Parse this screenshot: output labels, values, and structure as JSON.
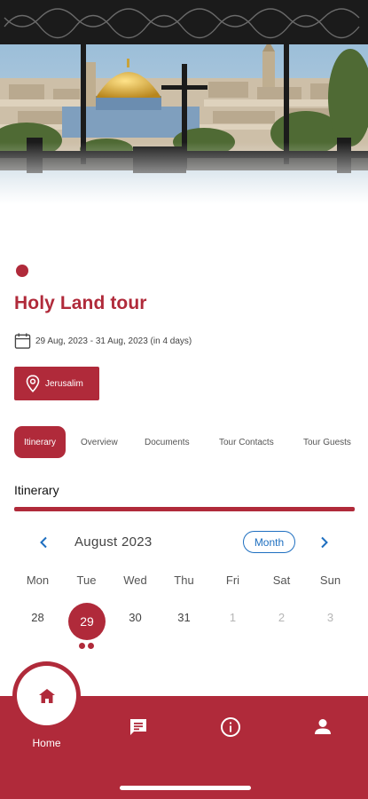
{
  "tour": {
    "title": "Holy Land tour",
    "dates": "29 Aug, 2023 - 31 Aug, 2023 (in 4 days)",
    "location": "Jerusalim"
  },
  "tabs": [
    "Itinerary",
    "Overview",
    "Documents",
    "Tour Contacts",
    "Tour Guests"
  ],
  "active_tab": "Itinerary",
  "section": {
    "title": "Itinerary"
  },
  "calendar": {
    "month": "August 2023",
    "view_button": "Month",
    "weekdays": [
      "Mon",
      "Tue",
      "Wed",
      "Thu",
      "Fri",
      "Sat",
      "Sun"
    ],
    "days": [
      "28",
      "29",
      "30",
      "31",
      "1",
      "2",
      "3"
    ],
    "selected_day": "29",
    "event_dots_on_selected": 2
  },
  "nav": {
    "home_label": "Home",
    "items": [
      "home-icon",
      "chat-icon",
      "info-icon",
      "profile-icon"
    ]
  },
  "colors": {
    "accent": "#b02a3a",
    "link": "#1e6fc0"
  },
  "icons": {
    "date": "calendar-icon",
    "location": "location-pin-icon",
    "prev": "chevron-left-icon",
    "next": "chevron-right-icon"
  }
}
